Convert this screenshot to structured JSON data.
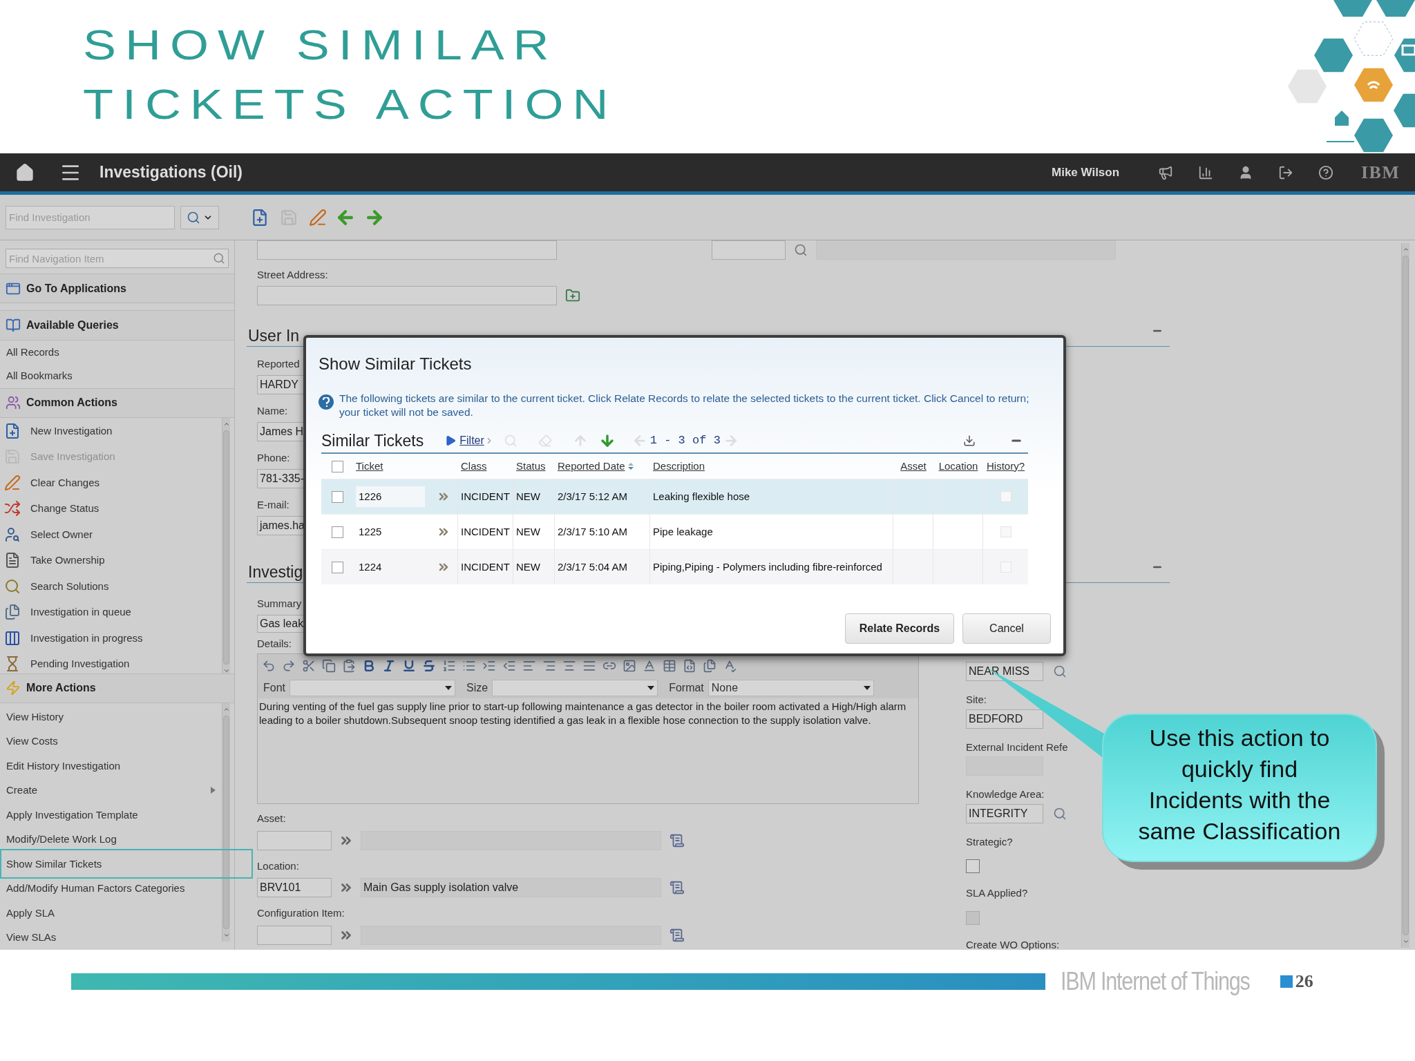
{
  "slide": {
    "title_lines": [
      "SHOW SIMILAR",
      "TICKETS ACTION"
    ],
    "footer_brand": "IBM Internet of Things",
    "page_number": "26"
  },
  "app": {
    "title": "Investigations (Oil)",
    "user": "Mike Wilson",
    "logo": "IBM"
  },
  "toolbar": {
    "search_placeholder": "Find Investigation"
  },
  "sidebar": {
    "search_placeholder": "Find Navigation Item",
    "applications": "Go To Applications",
    "queries": {
      "label": "Available Queries",
      "items": [
        "All Records",
        "All Bookmarks"
      ]
    },
    "common_actions": {
      "label": "Common Actions",
      "items": [
        {
          "label": "New Investigation",
          "disabled": false
        },
        {
          "label": "Save Investigation",
          "disabled": true
        },
        {
          "label": "Clear Changes",
          "disabled": false
        },
        {
          "label": "Change Status",
          "disabled": false
        },
        {
          "label": "Select Owner",
          "disabled": false
        },
        {
          "label": "Take Ownership",
          "disabled": false
        },
        {
          "label": "Search Solutions",
          "disabled": false
        },
        {
          "label": "Investigation in queue",
          "disabled": false
        },
        {
          "label": "Investigation in progress",
          "disabled": false
        },
        {
          "label": "Pending Investigation",
          "disabled": false
        }
      ]
    },
    "more_actions": {
      "label": "More Actions",
      "items": [
        {
          "label": "View History",
          "submenu": false,
          "highlighted": false
        },
        {
          "label": "View Costs",
          "submenu": false,
          "highlighted": false
        },
        {
          "label": "Edit History Investigation",
          "submenu": false,
          "highlighted": false
        },
        {
          "label": "Create",
          "submenu": true,
          "highlighted": false
        },
        {
          "label": "Apply Investigation Template",
          "submenu": false,
          "highlighted": false
        },
        {
          "label": "Modify/Delete Work Log",
          "submenu": false,
          "highlighted": false
        },
        {
          "label": "Show Similar Tickets",
          "submenu": false,
          "highlighted": true
        },
        {
          "label": "Add/Modify Human Factors Categories",
          "submenu": false,
          "highlighted": false
        },
        {
          "label": "Apply SLA",
          "submenu": false,
          "highlighted": false
        },
        {
          "label": "View SLAs",
          "submenu": false,
          "highlighted": false
        }
      ]
    }
  },
  "form": {
    "street_label": "Street Address:",
    "user_heading": "User In",
    "user_fields": [
      {
        "label": "Reported",
        "value": "HARDY"
      },
      {
        "label": "Name:",
        "value": "James H"
      },
      {
        "label": "Phone:",
        "value": "781-335-"
      },
      {
        "label": "E-mail:",
        "value": "james.ha"
      }
    ],
    "investigation_heading": "Investig",
    "summary_label": "Summary",
    "summary_value": "Gas leak",
    "details_label": "Details:",
    "editor": {
      "font_label": "Font",
      "size_label": "Size",
      "format_label": "Format",
      "format_value": "None",
      "text": "During venting of the fuel gas supply line prior to start-up following maintenance a gas detector in the boiler room activated a High/High alarm leading to a boiler shutdown.Subsequent snoop testing identified a gas leak in a flexible hose connection to the supply isolation valve."
    },
    "links": [
      {
        "label": "Asset:"
      },
      {
        "label": "Location:",
        "value": "BRV101",
        "description": "Main Gas supply isolation valve"
      },
      {
        "label": "Configuration Item:"
      }
    ],
    "right_fields": [
      {
        "kind": "field",
        "value": "NEAR MISS",
        "lookup": true,
        "disabled": false
      },
      {
        "kind": "label",
        "text": "Site:"
      },
      {
        "kind": "field",
        "value": "BEDFORD",
        "lookup": false,
        "disabled": false
      },
      {
        "kind": "label",
        "text": "External Incident Refe"
      },
      {
        "kind": "field",
        "lookup": false,
        "disabled": true
      },
      {
        "kind": "label",
        "text": "Knowledge Area:"
      },
      {
        "kind": "field",
        "value": "INTEGRITY",
        "lookup": true,
        "disabled": false
      },
      {
        "kind": "label",
        "text": "Strategic?"
      },
      {
        "kind": "checkbox",
        "checked": false,
        "disabled": false
      },
      {
        "kind": "label",
        "text": "SLA Applied?"
      },
      {
        "kind": "checkbox",
        "checked": false,
        "disabled": true
      },
      {
        "kind": "label",
        "text": "Create WO Options:"
      }
    ]
  },
  "dialog": {
    "title": "Show Similar Tickets",
    "info": "The following tickets are similar to the current ticket. Click Relate Records to relate the selected tickets to the current ticket. Click Cancel to return; your ticket will not be saved.",
    "table_title": "Similar Tickets",
    "filter": "Filter",
    "pagination": "1 - 3 of 3",
    "select_all_checked": false,
    "columns": [
      "Ticket",
      "Class",
      "Status",
      "Reported Date",
      "Description",
      "Asset",
      "Location",
      "History?"
    ],
    "rows": [
      {
        "selected": true,
        "checked": false,
        "ticket": "1226",
        "class": "INCIDENT",
        "status": "NEW",
        "reported_date": "2/3/17 5:12 AM",
        "description": "Leaking flexible hose",
        "history": false
      },
      {
        "selected": false,
        "checked": false,
        "ticket": "1225",
        "class": "INCIDENT",
        "status": "NEW",
        "reported_date": "2/3/17 5:10 AM",
        "description": "Pipe leakage",
        "history": false
      },
      {
        "selected": false,
        "checked": false,
        "ticket": "1224",
        "class": "INCIDENT",
        "status": "NEW",
        "reported_date": "2/3/17 5:04 AM",
        "description": "Piping,Piping - Polymers including fibre-reinforced",
        "history": false
      }
    ],
    "buttons": [
      "Relate Records",
      "Cancel"
    ]
  },
  "callout": {
    "lines": [
      "Use this action to",
      "quickly find",
      "Incidents with the",
      "same Classification"
    ]
  }
}
